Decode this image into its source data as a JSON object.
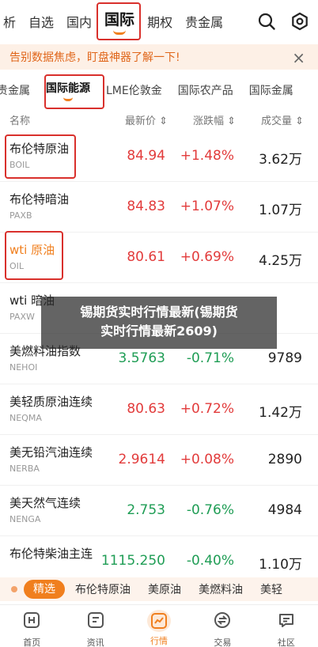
{
  "topnav": {
    "tabs": [
      {
        "label": "析",
        "active": false
      },
      {
        "label": "自选",
        "active": false
      },
      {
        "label": "国内",
        "active": false
      },
      {
        "label": "国际",
        "active": true
      },
      {
        "label": "期权",
        "active": false
      },
      {
        "label": "贵金属",
        "active": false
      }
    ],
    "search_icon": "search-icon",
    "settings_icon": "settings-icon"
  },
  "banner": {
    "text": "告别数据焦虑，盯盘神器了解一下!",
    "close": "×"
  },
  "subtabs": [
    {
      "label": "贵金属",
      "active": false
    },
    {
      "label": "国际能源",
      "active": true
    },
    {
      "label": "LME伦敦金",
      "active": false
    },
    {
      "label": "国际农产品",
      "active": false
    },
    {
      "label": "国际金属",
      "active": false
    }
  ],
  "table": {
    "headers": {
      "name": "名称",
      "price": "最新价 ⇕",
      "change": "涨跌幅 ⇕",
      "volume": "成交量 ⇕"
    },
    "rows": [
      {
        "name": "布伦特原油",
        "code": "BOIL",
        "price": "84.94",
        "change": "+1.48%",
        "volume": "3.62万",
        "dir": "up"
      },
      {
        "name": "布伦特暗油",
        "code": "PAXB",
        "price": "84.83",
        "change": "+1.07%",
        "volume": "1.07万",
        "dir": "up"
      },
      {
        "name": "wti 原油",
        "code": "OIL",
        "price": "80.61",
        "change": "+0.69%",
        "volume": "4.25万",
        "dir": "up"
      },
      {
        "name": "wti 暗油",
        "code": "PAXW",
        "price": "",
        "change": "",
        "volume": "",
        "dir": "up"
      },
      {
        "name": "美燃料油指数",
        "code": "NEHOI",
        "price": "3.5763",
        "change": "-0.71%",
        "volume": "9789",
        "dir": "down"
      },
      {
        "name": "美轻质原油连续",
        "code": "NEQMA",
        "price": "80.63",
        "change": "+0.72%",
        "volume": "1.42万",
        "dir": "up"
      },
      {
        "name": "美无铅汽油连续",
        "code": "NERBA",
        "price": "2.9614",
        "change": "+0.08%",
        "volume": "2890",
        "dir": "up"
      },
      {
        "name": "美天然气连续",
        "code": "NENGA",
        "price": "2.753",
        "change": "-0.76%",
        "volume": "4984",
        "dir": "down"
      },
      {
        "name": "布伦特柴油主连",
        "code": "",
        "price": "1115.250",
        "change": "-0.40%",
        "volume": "1.10万",
        "dir": "down"
      }
    ]
  },
  "watermark": {
    "line1": "锡期货实时行情最新(锡期货",
    "line2": "实时行情最新2609)"
  },
  "chips": {
    "items": [
      {
        "label": "精选",
        "active": true
      },
      {
        "label": "布伦特原油",
        "active": false
      },
      {
        "label": "美原油",
        "active": false
      },
      {
        "label": "美燃料油",
        "active": false
      },
      {
        "label": "美轻",
        "active": false
      }
    ]
  },
  "bottomnav": {
    "items": [
      {
        "label": "首页",
        "icon": "home-icon",
        "active": false
      },
      {
        "label": "资讯",
        "icon": "news-icon",
        "active": false
      },
      {
        "label": "行情",
        "icon": "chart-icon",
        "active": true
      },
      {
        "label": "交易",
        "icon": "trade-icon",
        "active": false
      },
      {
        "label": "社区",
        "icon": "community-icon",
        "active": false
      }
    ]
  },
  "colors": {
    "accent": "#f07f1e",
    "up": "#e23b3b",
    "down": "#1f9d55",
    "highlight_box": "#d9302c"
  }
}
